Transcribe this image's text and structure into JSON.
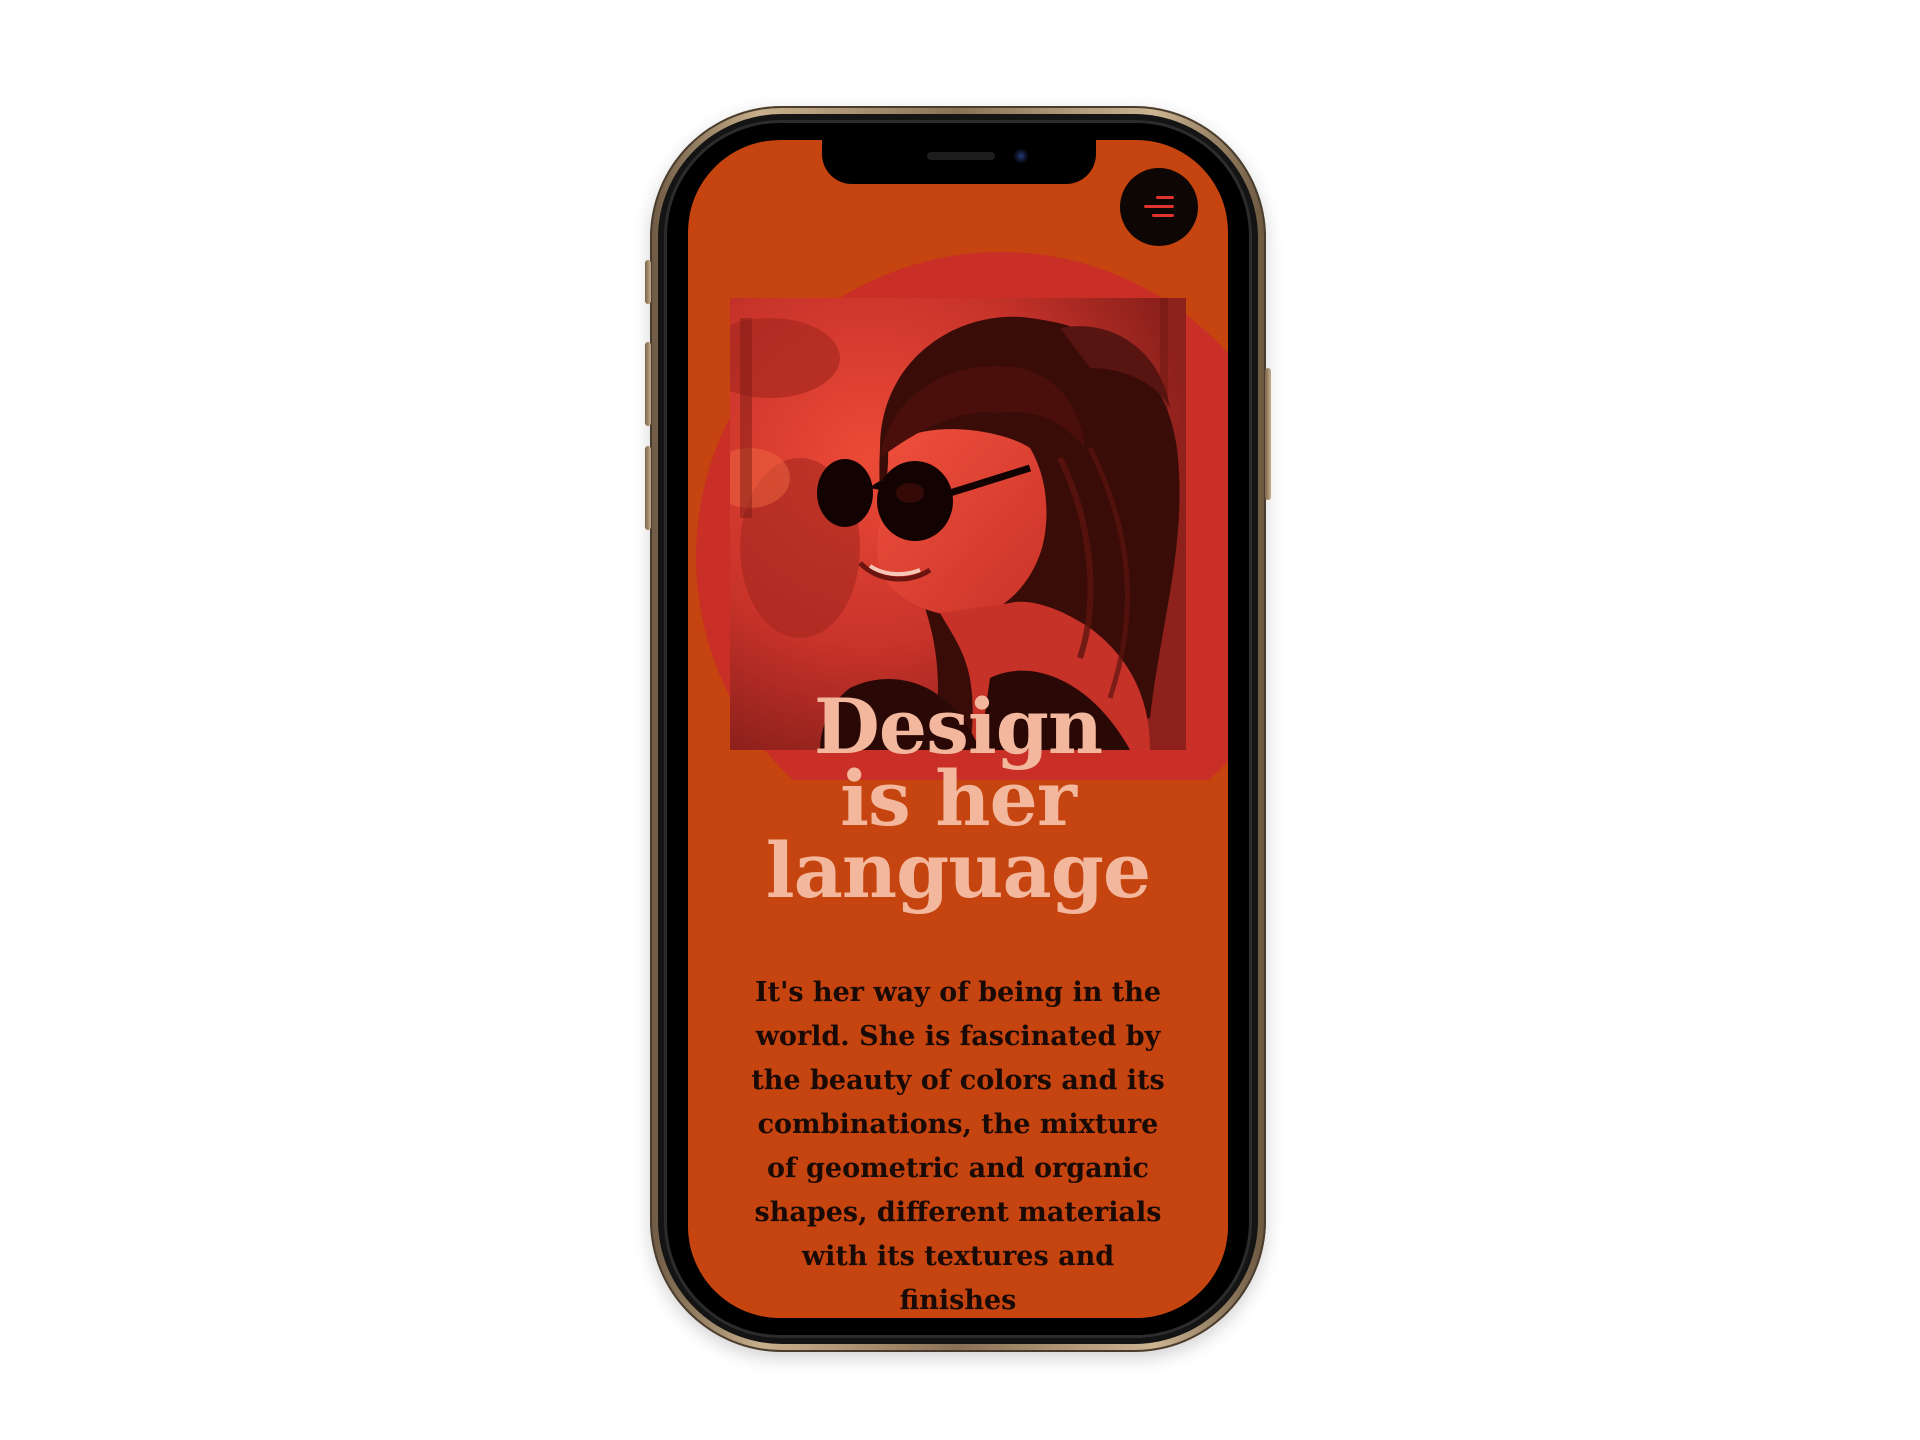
{
  "header": {
    "menu_icon": "hamburger-menu-icon"
  },
  "hero": {
    "photo_icon": "portrait-photo",
    "headline_lines": [
      "Design",
      "is her",
      "language"
    ]
  },
  "intro": {
    "text": "It's her way of being in the world. She is fascinated by the beauty of colors and its combinations, the mixture of geometric and organic shapes, different materials with its textures and finishes"
  },
  "colors": {
    "background": "#c5440f",
    "accent_shape": "#c92e28",
    "headline": "#f2b79c",
    "body_text": "#1a0a05",
    "menu_button": "#0d0604",
    "menu_icon": "#e1332b"
  }
}
